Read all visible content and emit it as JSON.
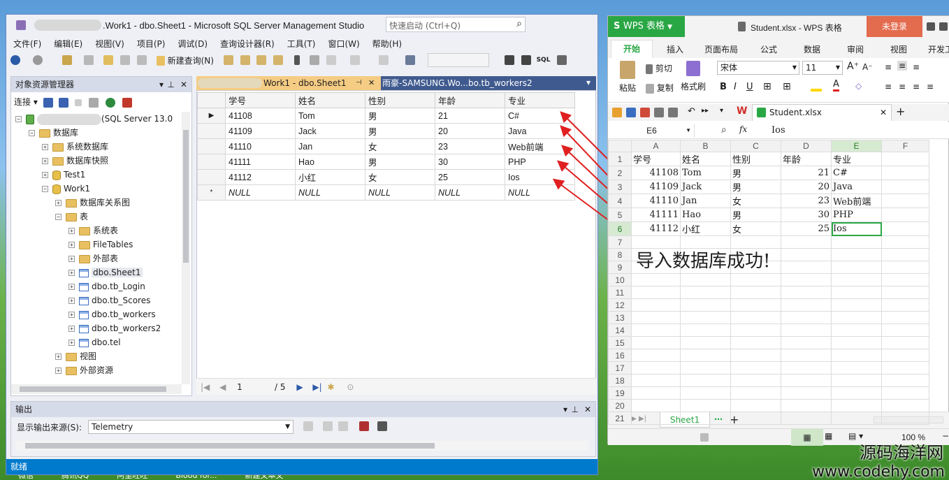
{
  "ssms": {
    "title": ".Work1 - dbo.Sheet1 - Microsoft SQL Server Management Studio",
    "quick_launch": "快速启动 (Ctrl+Q)",
    "menu": [
      "文件(F)",
      "编辑(E)",
      "视图(V)",
      "项目(P)",
      "调试(D)",
      "查询设计器(R)",
      "工具(T)",
      "窗口(W)",
      "帮助(H)"
    ],
    "new_query": "新建查询(N)",
    "object_explorer": {
      "title": "对象资源管理器",
      "connect": "连接",
      "server": "(SQL Server 13.0",
      "tree": [
        {
          "label": "数据库",
          "indent": 1,
          "exp": "−",
          "icon": "fold"
        },
        {
          "label": "系统数据库",
          "indent": 2,
          "exp": "+",
          "icon": "fold"
        },
        {
          "label": "数据库快照",
          "indent": 2,
          "exp": "+",
          "icon": "fold"
        },
        {
          "label": "Test1",
          "indent": 2,
          "exp": "+",
          "icon": "db"
        },
        {
          "label": "Work1",
          "indent": 2,
          "exp": "−",
          "icon": "db"
        },
        {
          "label": "数据库关系图",
          "indent": 3,
          "exp": "+",
          "icon": "fold"
        },
        {
          "label": "表",
          "indent": 3,
          "exp": "−",
          "icon": "fold"
        },
        {
          "label": "系统表",
          "indent": 4,
          "exp": "+",
          "icon": "fold"
        },
        {
          "label": "FileTables",
          "indent": 4,
          "exp": "+",
          "icon": "fold"
        },
        {
          "label": "外部表",
          "indent": 4,
          "exp": "+",
          "icon": "fold"
        },
        {
          "label": "dbo.Sheet1",
          "indent": 4,
          "exp": "+",
          "icon": "tbl"
        },
        {
          "label": "dbo.tb_Login",
          "indent": 4,
          "exp": "+",
          "icon": "tbl"
        },
        {
          "label": "dbo.tb_Scores",
          "indent": 4,
          "exp": "+",
          "icon": "tbl"
        },
        {
          "label": "dbo.tb_workers",
          "indent": 4,
          "exp": "+",
          "icon": "tbl"
        },
        {
          "label": "dbo.tb_workers2",
          "indent": 4,
          "exp": "+",
          "icon": "tbl"
        },
        {
          "label": "dbo.tel",
          "indent": 4,
          "exp": "+",
          "icon": "tbl"
        },
        {
          "label": "视图",
          "indent": 3,
          "exp": "+",
          "icon": "fold"
        },
        {
          "label": "外部资源",
          "indent": 3,
          "exp": "+",
          "icon": "fold"
        }
      ]
    },
    "tabs": [
      {
        "label": "Work1 - dbo.Sheet1"
      },
      {
        "label": "雨豪-SAMSUNG.Wo...bo.tb_workers2"
      }
    ],
    "grid": {
      "columns": [
        "学号",
        "姓名",
        "性别",
        "年龄",
        "专业"
      ],
      "rows": [
        [
          "41108",
          "Tom",
          "男",
          "21",
          "C#"
        ],
        [
          "41109",
          "Jack",
          "男",
          "20",
          "Java"
        ],
        [
          "41110",
          "Jan",
          "女",
          "23",
          "Web前端"
        ],
        [
          "41111",
          "Hao",
          "男",
          "30",
          "PHP"
        ],
        [
          "41112",
          "小红",
          "女",
          "25",
          "Ios"
        ],
        [
          "NULL",
          "NULL",
          "NULL",
          "NULL",
          "NULL"
        ]
      ]
    },
    "pager": {
      "page": "1",
      "total": "/ 5"
    },
    "output": {
      "title": "输出",
      "source_label": "显示输出来源(S):",
      "source_value": "Telemetry"
    },
    "status": "就绪"
  },
  "wps": {
    "app": "WPS 表格",
    "title": "Student.xlsx - WPS 表格",
    "login": "未登录",
    "ribbon_tabs": [
      "开始",
      "插入",
      "页面布局",
      "公式",
      "数据",
      "审阅",
      "视图",
      "开发工"
    ],
    "paste": "粘贴",
    "cut": "剪切",
    "copy": "复制",
    "format_painter": "格式刷",
    "font": "宋体",
    "size": "11",
    "doc_tab": "Student.xlsx",
    "cell_ref": "E6",
    "formula": "Ios",
    "col_headers": [
      "A",
      "B",
      "C",
      "D",
      "E",
      "F"
    ],
    "rows": [
      [
        "学号",
        "姓名",
        "性别",
        "年龄",
        "专业"
      ],
      [
        "41108",
        "Tom",
        "男",
        "21",
        "C#"
      ],
      [
        "41109",
        "Jack",
        "男",
        "20",
        "Java"
      ],
      [
        "41110",
        "Jan",
        "女",
        "23",
        "Web前端"
      ],
      [
        "41111",
        "Hao",
        "男",
        "30",
        "PHP"
      ],
      [
        "41112",
        "小红",
        "女",
        "25",
        "Ios"
      ]
    ],
    "row_numbers": [
      "1",
      "2",
      "3",
      "4",
      "5",
      "6",
      "7",
      "8",
      "9",
      "10",
      "11",
      "12",
      "13",
      "14",
      "15",
      "16",
      "17",
      "18",
      "19",
      "20",
      "21"
    ],
    "message": "导入数据库成功!",
    "sheet": "Sheet1",
    "zoom": "100 %"
  },
  "watermark": {
    "line1": "源码海洋网",
    "line2": "www.codehy.com"
  },
  "taskbar": [
    "微信",
    "腾讯QQ",
    "阿里旺旺",
    "Blood for...",
    "新建文本文"
  ]
}
